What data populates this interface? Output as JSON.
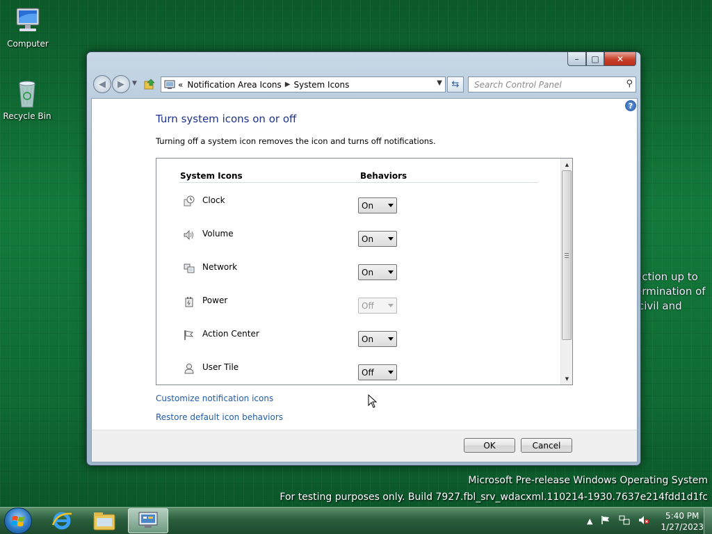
{
  "desktop": {
    "icons": [
      {
        "label": "Computer",
        "icon": "computer-icon"
      },
      {
        "label": "Recycle Bin",
        "icon": "recycle-bin-icon"
      }
    ],
    "behind_text": [
      "action up to",
      "ermination of",
      "civil and"
    ],
    "watermark": {
      "line1": "Microsoft Pre-release Windows Operating System",
      "line2": "For testing purposes only. Build 7927.fbl_srv_wdacxml.110214-1930.7637e214fdd1d1fc"
    },
    "colors": {
      "background": "#137a3a",
      "link": "#1f5ca8",
      "title": "#1e3287"
    }
  },
  "window": {
    "caption_buttons": {
      "minimize": "–",
      "maximize": "□",
      "close": "✕"
    },
    "breadcrumb": {
      "overflow": "«",
      "items": [
        "Notification Area Icons",
        "System Icons"
      ]
    },
    "search": {
      "placeholder": "Search Control Panel"
    },
    "help_label": "?",
    "title": "Turn system icons on or off",
    "description": "Turning off a system icon removes the icon and turns off notifications.",
    "table": {
      "headers": {
        "icons": "System Icons",
        "behaviors": "Behaviors"
      },
      "rows": [
        {
          "label": "Clock",
          "icon": "clock-icon",
          "value": "On",
          "enabled": true
        },
        {
          "label": "Volume",
          "icon": "volume-icon",
          "value": "On",
          "enabled": true
        },
        {
          "label": "Network",
          "icon": "network-icon",
          "value": "On",
          "enabled": true
        },
        {
          "label": "Power",
          "icon": "power-icon",
          "value": "Off",
          "enabled": false
        },
        {
          "label": "Action Center",
          "icon": "action-center-flag-icon",
          "value": "On",
          "enabled": true
        },
        {
          "label": "User Tile",
          "icon": "user-tile-icon",
          "value": "Off",
          "enabled": true
        }
      ]
    },
    "links": {
      "customize": "Customize notification icons",
      "restore": "Restore default icon behaviors"
    },
    "buttons": {
      "ok": "OK",
      "cancel": "Cancel"
    }
  },
  "taskbar": {
    "apps": [
      "internet-explorer-icon",
      "windows-explorer-icon",
      "control-panel-icon"
    ],
    "tray": {
      "show_hidden": "▲",
      "time": "5:40 PM",
      "date": "1/27/2023"
    }
  }
}
